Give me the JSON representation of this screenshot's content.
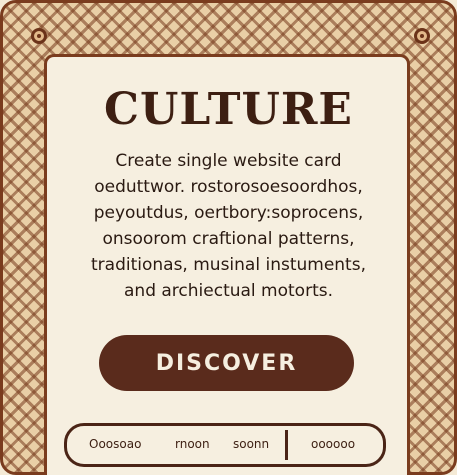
{
  "card": {
    "title": "CULTURE",
    "description_lines": [
      "Create single website card",
      "oeduttwor. rostorosoesoordhos,",
      "peyoutdus, oertbory:soprocens,",
      "onsoorom craftional patterns,",
      "traditionas, musinal instuments,",
      "and archiectual motorts."
    ],
    "cta_label": "DISCOVER",
    "footer_left_1": "Ooosoao",
    "footer_left_2": "rnoon",
    "footer_left_3": "soonn",
    "footer_right": "oooooo"
  },
  "colors": {
    "accent": "#5a2b1c",
    "border": "#7a3c1e",
    "background": "#f6efe0"
  }
}
